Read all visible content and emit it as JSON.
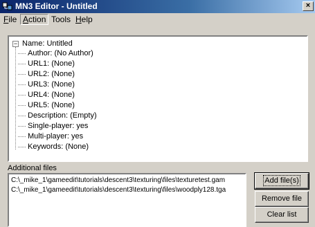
{
  "window": {
    "title": "MN3 Editor - Untitled",
    "close_glyph": "×"
  },
  "menu": [
    {
      "accel": "F",
      "rest": "ile"
    },
    {
      "accel": "A",
      "rest": "ction"
    },
    {
      "accel": "",
      "rest": "Tools"
    },
    {
      "accel": "H",
      "rest": "elp"
    }
  ],
  "tree": {
    "root_toggle": "−",
    "root_label": "Name: Untitled",
    "children": [
      "Author: (No Author)",
      "URL1: (None)",
      "URL2: (None)",
      "URL3: (None)",
      "URL4: (None)",
      "URL5: (None)",
      "Description: (Empty)",
      "Single-player: yes",
      "Multi-player: yes",
      "Keywords: (None)"
    ]
  },
  "files": {
    "label": "Additional files",
    "items": [
      "C:\\_mike_1\\gameedit\\tutorials\\descent3\\texturing\\files\\texturetest.gam",
      "C:\\_mike_1\\gameedit\\tutorials\\descent3\\texturing\\files\\woodply128.tga"
    ]
  },
  "buttons": {
    "add": "Add file(s)",
    "remove": "Remove file",
    "clear": "Clear list"
  },
  "colors": {
    "title_start": "#0a246a",
    "title_end": "#a6caf0",
    "face": "#d4d0c8"
  }
}
